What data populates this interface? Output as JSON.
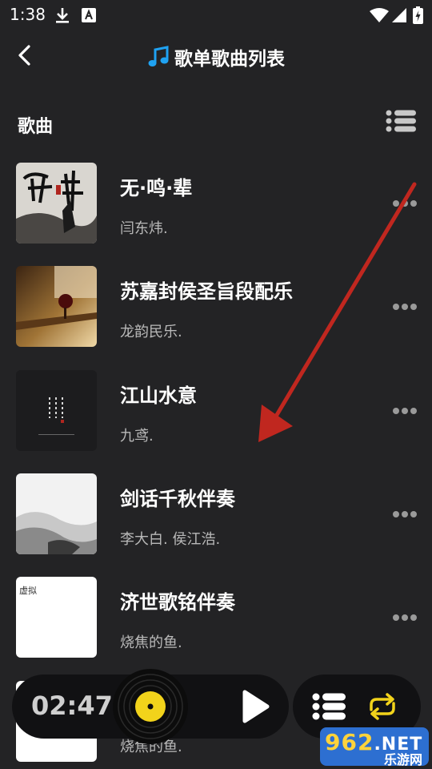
{
  "status_bar": {
    "time": "1:38"
  },
  "header": {
    "title": "歌单歌曲列表"
  },
  "section": {
    "label": "歌曲"
  },
  "songs": [
    {
      "title": "无·鸣·辈",
      "artist": "闫东炜."
    },
    {
      "title": "苏嘉封侯圣旨段配乐",
      "artist": "龙韵民乐."
    },
    {
      "title": "江山水意",
      "artist": "九鸢."
    },
    {
      "title": "剑话千秋伴奏",
      "artist": "李大白. 侯江浩."
    },
    {
      "title": "济世歌铭伴奏",
      "artist": "烧焦的鱼.",
      "cover_text": "虚拟"
    },
    {
      "title": "",
      "artist": "烧焦的鱼."
    }
  ],
  "player": {
    "elapsed": "02:47"
  },
  "watermark": {
    "brand": "962",
    "suffix": ".NET",
    "site": "乐游网"
  },
  "colors": {
    "background": "#232325",
    "panel": "#111113",
    "disc_label": "#f2d31b",
    "loop_icon": "#f2d31b",
    "note_icon": "#1fa2f2",
    "annotation_arrow": "#c0271f"
  }
}
